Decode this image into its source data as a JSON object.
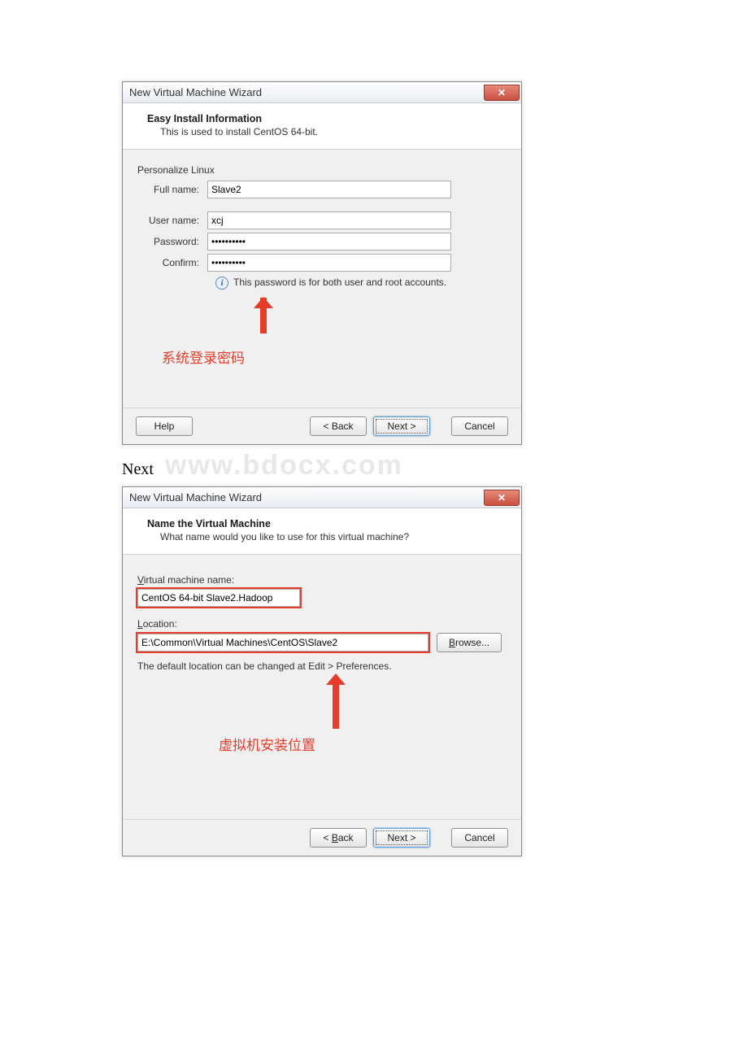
{
  "dialog1": {
    "title": "New Virtual Machine Wizard",
    "close_glyph": "✕",
    "header_title": "Easy Install Information",
    "header_sub": "This is used to install CentOS 64-bit.",
    "section": "Personalize Linux",
    "labels": {
      "full_name": "Full name:",
      "user_name": "User name:",
      "password": "Password:",
      "confirm": "Confirm:"
    },
    "values": {
      "full_name": "Slave2",
      "user_name": "xcj",
      "password": "••••••••••",
      "confirm": "••••••••••"
    },
    "info_text": "This password is for both user and root accounts.",
    "annotation": "系统登录密码",
    "buttons": {
      "help": "Help",
      "back": "< Back",
      "next": "Next >",
      "cancel": "Cancel"
    }
  },
  "mid": {
    "caption": "Next",
    "watermark": "www.bdocx.com"
  },
  "dialog2": {
    "title": "New Virtual Machine Wizard",
    "close_glyph": "✕",
    "header_title": "Name the Virtual Machine",
    "header_sub": "What name would you like to use for this virtual machine?",
    "vm_name_label_pre": "V",
    "vm_name_label_rest": "irtual machine name:",
    "vm_name_value": "CentOS 64-bit Slave2.Hadoop",
    "location_label_pre": "L",
    "location_label_rest": "ocation:",
    "location_value": "E:\\Common\\Virtual Machines\\CentOS\\Slave2",
    "browse_pre": "B",
    "browse_rest": "rowse...",
    "default_note": "The default location can be changed at Edit > Preferences.",
    "annotation": "虚拟机安装位置",
    "buttons": {
      "back_pre": "< ",
      "back_u": "B",
      "back_rest": "ack",
      "next": "Next >",
      "cancel": "Cancel"
    }
  }
}
